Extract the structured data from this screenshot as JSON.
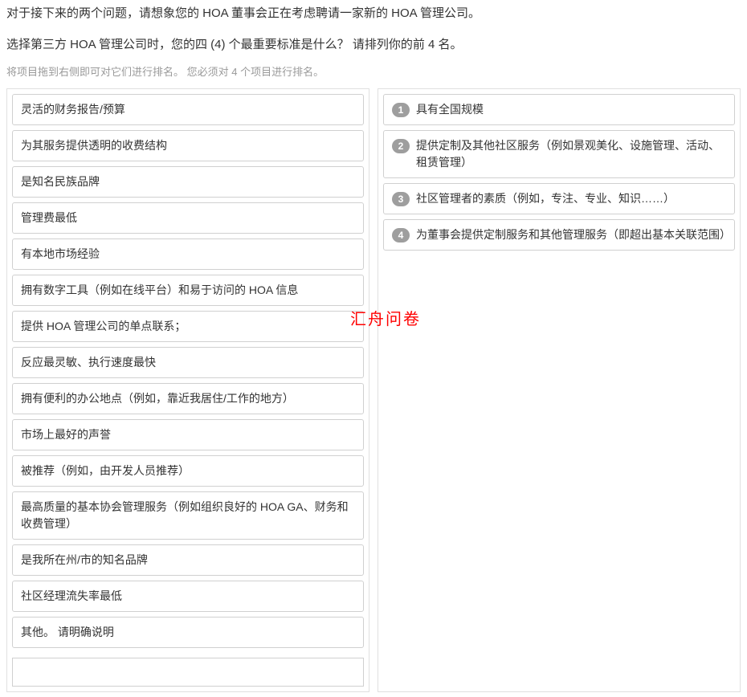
{
  "intro": "对于接下来的两个问题，请想象您的 HOA 董事会正在考虑聘请一家新的 HOA 管理公司。",
  "question": "选择第三方 HOA 管理公司时，您的四 (4) 个最重要标准是什么？   请排列你的前 4 名。",
  "hint": "将项目拖到右侧即可对它们进行排名。 您必须对 4 个项目进行排名。",
  "watermark": "汇舟问卷",
  "left_items": [
    "灵活的财务报告/预算",
    "为其服务提供透明的收费结构",
    "是知名民族品牌",
    "管理费最低",
    "有本地市场经验",
    "拥有数字工具（例如在线平台）和易于访问的 HOA 信息",
    "提供 HOA 管理公司的单点联系；",
    "反应最灵敏、执行速度最快",
    "拥有便利的办公地点（例如，靠近我居住/工作的地方）",
    "市场上最好的声誉",
    "被推荐（例如，由开发人员推荐）",
    "最高质量的基本协会管理服务（例如组织良好的 HOA GA、财务和收费管理）",
    "是我所在州/市的知名品牌",
    "社区经理流失率最低",
    "其他。  请明确说明"
  ],
  "right_items": [
    {
      "rank": "1",
      "text": "具有全国规模"
    },
    {
      "rank": "2",
      "text": "提供定制及其他社区服务（例如景观美化、设施管理、活动、租赁管理）"
    },
    {
      "rank": "3",
      "text": "社区管理者的素质（例如，专注、专业、知识……）"
    },
    {
      "rank": "4",
      "text": "为董事会提供定制服务和其他管理服务（即超出基本关联范围）"
    }
  ],
  "other_placeholder": ""
}
